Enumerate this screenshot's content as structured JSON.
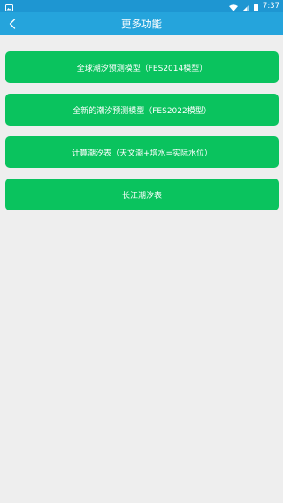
{
  "status_bar": {
    "time": "7:37",
    "icons": [
      "image-notification-icon",
      "wifi-icon",
      "signal-icon",
      "battery-icon"
    ]
  },
  "app_bar": {
    "title": "更多功能",
    "back_icon": "chevron-left-icon"
  },
  "menu": {
    "items": [
      {
        "label": "全球潮汐预测模型（FES2014模型）"
      },
      {
        "label": "全新的潮汐预测模型（FES2022模型）"
      },
      {
        "label": "计算潮汐表（天文潮+增水=实际水位）"
      },
      {
        "label": "长江潮汐表"
      }
    ]
  },
  "colors": {
    "status_bar": "#1e96d2",
    "app_bar": "#25a4dc",
    "button": "#0ac35e",
    "background": "#eeeeee"
  }
}
